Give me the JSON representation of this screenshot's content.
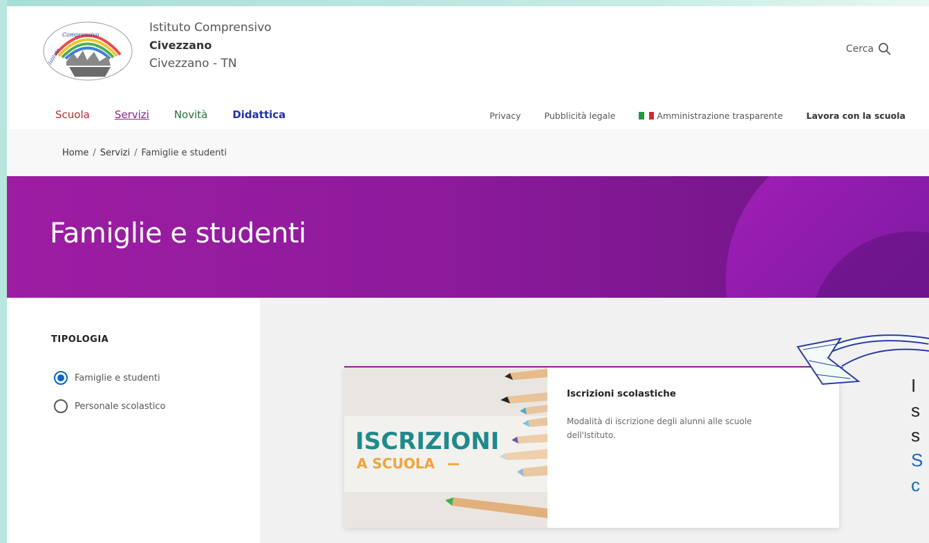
{
  "header": {
    "school_line1": "Istituto Comprensivo",
    "school_line2": "Civezzano",
    "school_line3": "Civezzano - TN",
    "search_label": "Cerca",
    "logo_alt": "Istituto Comprensivo Civezzano"
  },
  "nav": {
    "main": [
      "Scuola",
      "Servizi",
      "Novità",
      "Didattica"
    ],
    "secondary": {
      "privacy": "Privacy",
      "pubblicita": "Pubblicità legale",
      "amministrazione": "Amministrazione trasparente",
      "lavora": "Lavora con la scuola"
    }
  },
  "breadcrumb": [
    "Home",
    "Servizi",
    "Famiglie e studenti"
  ],
  "hero": {
    "title": "Famiglie e studenti"
  },
  "sidebar": {
    "title": "TIPOLOGIA",
    "options": [
      {
        "label": "Famiglie e studenti",
        "checked": true
      },
      {
        "label": "Personale scolastico",
        "checked": false
      }
    ]
  },
  "card": {
    "image_text_1": "ISCRIZIONI",
    "image_text_2": "A SCUOLA",
    "title": "Iscrizioni scolastiche",
    "description": "Modalità di iscrizione degli alunni alle scuole dell'Istituto."
  },
  "overlay": {
    "lines": [
      "I",
      "s",
      "s",
      "S",
      "c"
    ]
  },
  "colors": {
    "hero": "#9d1da3",
    "servizi": "#8e1e8f",
    "scuola": "#c0272d",
    "novita": "#236e39",
    "didattica": "#2130a8",
    "radio_checked": "#0066cc",
    "image_teal": "#1e8a8c",
    "image_orange": "#f0a43c"
  }
}
